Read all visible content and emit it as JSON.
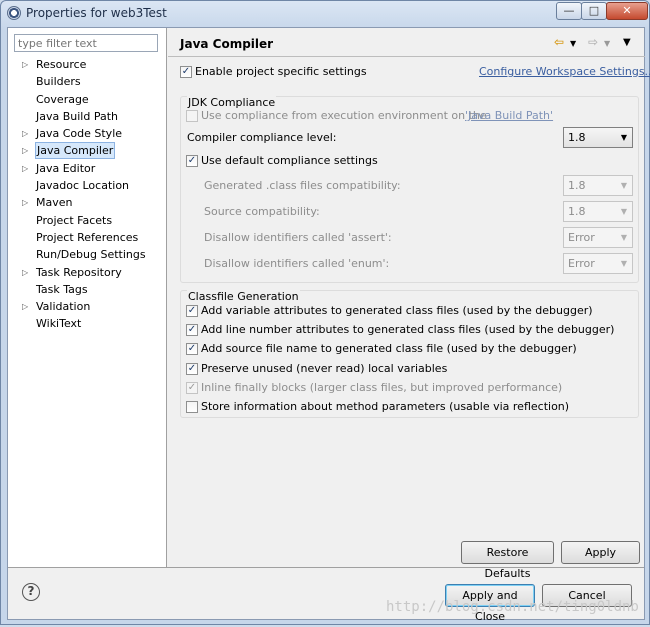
{
  "window": {
    "title": "Properties for web3Test",
    "icons": {
      "app": "eclipse-icon",
      "minimize": "minimize-icon",
      "maximize": "maximize-icon",
      "close": "close-icon"
    }
  },
  "sidebar": {
    "filter_placeholder": "type filter text",
    "items": [
      {
        "label": "Resource",
        "expandable": true
      },
      {
        "label": "Builders",
        "expandable": false
      },
      {
        "label": "Coverage",
        "expandable": false
      },
      {
        "label": "Java Build Path",
        "expandable": false
      },
      {
        "label": "Java Code Style",
        "expandable": true
      },
      {
        "label": "Java Compiler",
        "expandable": true,
        "selected": true
      },
      {
        "label": "Java Editor",
        "expandable": true
      },
      {
        "label": "Javadoc Location",
        "expandable": false
      },
      {
        "label": "Maven",
        "expandable": true
      },
      {
        "label": "Project Facets",
        "expandable": false
      },
      {
        "label": "Project References",
        "expandable": false
      },
      {
        "label": "Run/Debug Settings",
        "expandable": false
      },
      {
        "label": "Task Repository",
        "expandable": true
      },
      {
        "label": "Task Tags",
        "expandable": false
      },
      {
        "label": "Validation",
        "expandable": true
      },
      {
        "label": "WikiText",
        "expandable": false
      }
    ]
  },
  "page": {
    "title": "Java Compiler",
    "nav_icons": {
      "back": "back-arrow-icon",
      "forward": "forward-arrow-icon",
      "menu": "view-menu-icon"
    },
    "enable_project_specific": {
      "label": "Enable project specific settings",
      "checked": true
    },
    "configure_workspace_link": "Configure Workspace Settings...",
    "jdk": {
      "group_title": "JDK Compliance",
      "use_compliance_from_env": {
        "label": "Use compliance from execution environment on the",
        "link": "'Java Build Path'",
        "checked": false
      },
      "compliance_level_label": "Compiler compliance level:",
      "compliance_level_value": "1.8",
      "use_default": {
        "label": "Use default compliance settings",
        "checked": true
      },
      "rows": [
        {
          "label": "Generated .class files compatibility:",
          "value": "1.8"
        },
        {
          "label": "Source compatibility:",
          "value": "1.8"
        },
        {
          "label": "Disallow identifiers called 'assert':",
          "value": "Error"
        },
        {
          "label": "Disallow identifiers called 'enum':",
          "value": "Error"
        }
      ]
    },
    "classfile": {
      "group_title": "Classfile Generation",
      "options": [
        {
          "label": "Add variable attributes to generated class files (used by the debugger)",
          "checked": true,
          "disabled": false
        },
        {
          "label": "Add line number attributes to generated class files (used by the debugger)",
          "checked": true,
          "disabled": false
        },
        {
          "label": "Add source file name to generated class file (used by the debugger)",
          "checked": true,
          "disabled": false
        },
        {
          "label": "Preserve unused (never read) local variables",
          "checked": true,
          "disabled": false
        },
        {
          "label": "Inline finally blocks (larger class files, but improved performance)",
          "checked": true,
          "disabled": true
        },
        {
          "label": "Store information about method parameters (usable via reflection)",
          "checked": false,
          "disabled": false
        }
      ]
    },
    "buttons": {
      "restore_defaults": "Restore Defaults",
      "apply": "Apply"
    }
  },
  "footer": {
    "help_icon": "help-icon",
    "help_glyph": "?",
    "apply_and_close": "Apply and Close",
    "cancel": "Cancel"
  },
  "watermark": "http://blog.csdn.net/ting0ldnb"
}
